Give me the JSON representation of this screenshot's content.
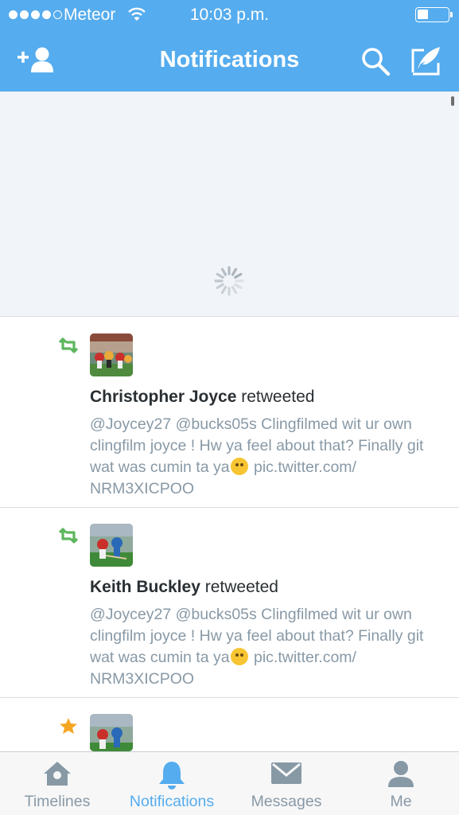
{
  "status_bar": {
    "carrier": "Meteor",
    "time": "10:03 p.m.",
    "battery_level": 0.35,
    "signal_bars": 4,
    "signal_max": 5
  },
  "nav": {
    "title": "Notifications",
    "add_user_icon": "add-user-icon",
    "search_icon": "search-icon",
    "compose_icon": "compose-tweet-icon"
  },
  "refresh": {
    "spinner_icon": "loading-spinner-icon"
  },
  "notifications": [
    {
      "type": "retweet",
      "icon": "retweet-icon",
      "user": "Christopher Joyce",
      "action": "retweeted",
      "tweet": "@Joycey27 @bucks05s Clingfilmed wit ur own clingfilm joyce ! Hw ya feel about that? Finally git wat was cumin ta ya",
      "emoji": "smiling-face",
      "link": "pic.twitter.com/",
      "link2": "NRM3XICPOO"
    },
    {
      "type": "retweet",
      "icon": "retweet-icon",
      "user": "Keith Buckley",
      "action": "retweeted",
      "tweet": "@Joycey27 @bucks05s Clingfilmed wit ur own clingfilm joyce ! Hw ya feel about that? Finally git wat was cumin ta ya",
      "emoji": "smiling-face",
      "link": "pic.twitter.com/",
      "link2": "NRM3XICPOO"
    },
    {
      "type": "favorite",
      "icon": "star-icon"
    }
  ],
  "tabs": [
    {
      "label": "Timelines",
      "icon": "home-icon",
      "active": false
    },
    {
      "label": "Notifications",
      "icon": "bell-icon",
      "active": true
    },
    {
      "label": "Messages",
      "icon": "envelope-icon",
      "active": false
    },
    {
      "label": "Me",
      "icon": "profile-icon",
      "active": false
    }
  ],
  "colors": {
    "brand": "#55acee",
    "retweet": "#5db65e",
    "favorite": "#f5a623",
    "text_primary": "#292f33",
    "text_secondary": "#8899a6"
  }
}
